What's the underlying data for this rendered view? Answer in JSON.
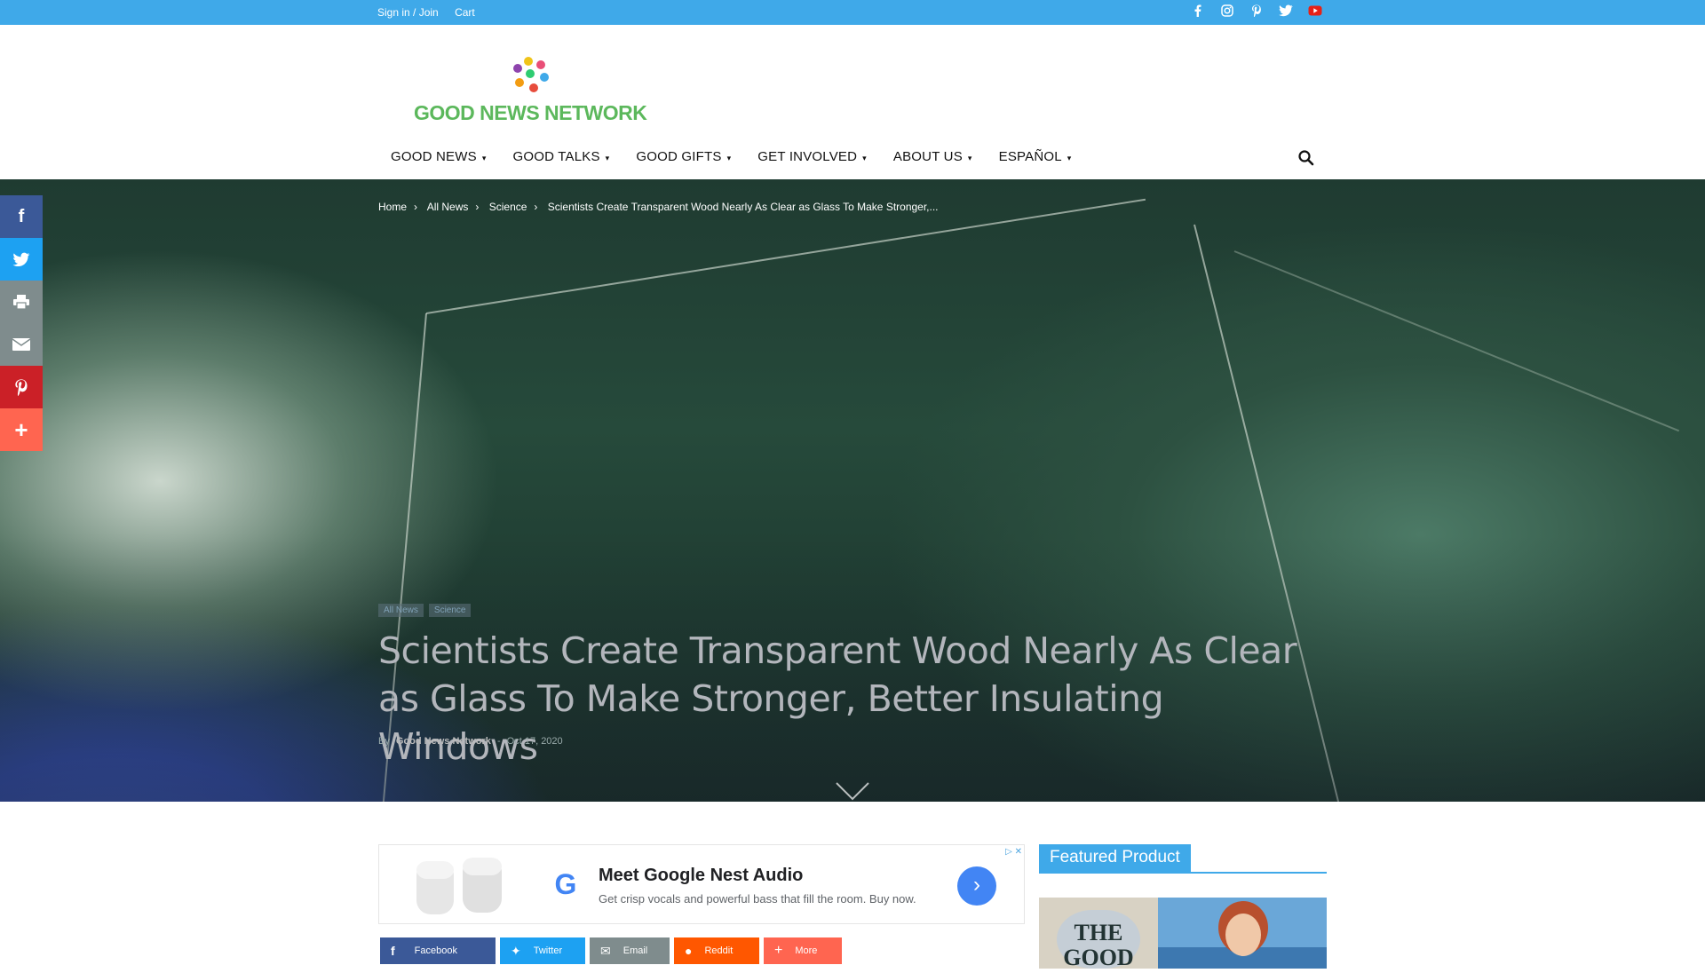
{
  "topbar": {
    "signin_label": "Sign in / Join",
    "cart_label": "Cart",
    "social_icons": [
      "facebook-icon",
      "instagram-icon",
      "pinterest-icon",
      "twitter-icon",
      "youtube-icon"
    ]
  },
  "logo": {
    "text": "GOOD NEWS NETWORK",
    "colors": {
      "text": "#5cb85c",
      "dots": [
        "#f0c419",
        "#e94e77",
        "#8e44ad",
        "#2ecc71",
        "#3fa9e9",
        "#f39c12",
        "#e74c3c"
      ]
    }
  },
  "nav": {
    "items": [
      {
        "label": "GOOD NEWS"
      },
      {
        "label": "GOOD TALKS"
      },
      {
        "label": "GOOD GIFTS"
      },
      {
        "label": "GET INVOLVED"
      },
      {
        "label": "ABOUT US"
      },
      {
        "label": "ESPAÑOL"
      }
    ]
  },
  "breadcrumb": {
    "items": [
      "Home",
      "All News",
      "Science",
      "Scientists Create Transparent Wood Nearly As Clear as Glass To Make Stronger,..."
    ],
    "separator": "›"
  },
  "article": {
    "categories": [
      "All News",
      "Science"
    ],
    "title": "Scientists Create Transparent Wood Nearly As Clear as Glass To Make Stronger, Better Insulating Windows",
    "by_label": "By",
    "author": "Good News Network",
    "dash": "-",
    "date": "Oct 17, 2020"
  },
  "side_share": {
    "buttons": [
      {
        "name": "facebook",
        "glyph": "f",
        "color": "#3b5998"
      },
      {
        "name": "twitter",
        "glyph": "t",
        "color": "#1da1f2"
      },
      {
        "name": "print",
        "glyph": "⎙",
        "color": "#7f8c8d"
      },
      {
        "name": "email",
        "glyph": "✉",
        "color": "#7f8c8d"
      },
      {
        "name": "pinterest",
        "glyph": "P",
        "color": "#cb2027"
      },
      {
        "name": "more",
        "glyph": "+",
        "color": "#ff6550"
      }
    ]
  },
  "ad": {
    "headline": "Meet Google Nest Audio",
    "description": "Get crisp vocals and powerful bass that fill the room. Buy now.",
    "logo_letter": "G"
  },
  "share_row": {
    "buttons": [
      {
        "label": "Facebook",
        "color": "#3b5998"
      },
      {
        "label": "Twitter",
        "color": "#1da1f2"
      },
      {
        "label": "Email",
        "color": "#7f8c8d"
      },
      {
        "label": "Reddit",
        "color": "#ff5700"
      },
      {
        "label": "More",
        "color": "#ff6550"
      }
    ]
  },
  "sidebar": {
    "featured_title": "Featured Product"
  }
}
